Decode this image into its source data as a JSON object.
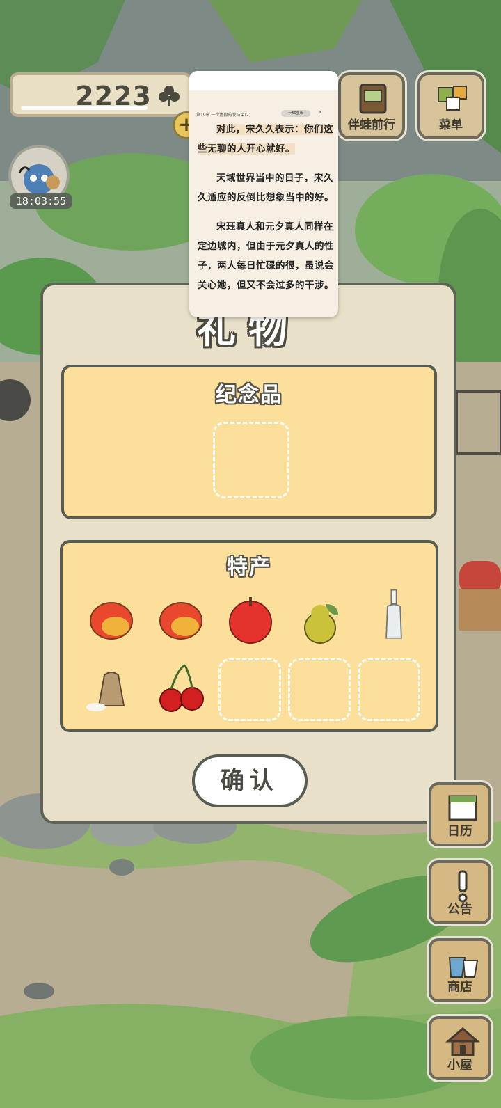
{
  "hud": {
    "clover_count": "2223",
    "plus_label": "+",
    "timer": "18:03:55"
  },
  "top_buttons": {
    "travel_label": "伴蛙前行",
    "menu_label": "菜单"
  },
  "reader": {
    "chapter": "第19章 一个虚假的发结束(2)",
    "pill": "一50金币",
    "close": "×",
    "paragraphs": [
      "对此，宋久久表示：你们这些无聊的人开心就好。",
      "天域世界当中的日子，宋久久适应的反倒比想象当中的好。",
      "宋珏真人和元夕真人同样在定边城内，但由于元夕真人的性子，两人每日忙碌的很，虽说会关心她，但又不会过多的干涉。"
    ]
  },
  "dialog": {
    "title": "礼物",
    "souvenir_title": "纪念品",
    "specialty_title": "特产",
    "confirm_label": "确认",
    "specialty_items": [
      "mango",
      "mango",
      "apple",
      "pear",
      "glass-bottle",
      "rice-sack",
      "cherries"
    ]
  },
  "side_menu": {
    "calendar_label": "日历",
    "notice_label": "公告",
    "shop_label": "商店",
    "house_label": "小屋"
  },
  "colors": {
    "panel_fill": "#fddf9c",
    "dialog_fill": "#e8e0c8",
    "border": "#585d52"
  }
}
